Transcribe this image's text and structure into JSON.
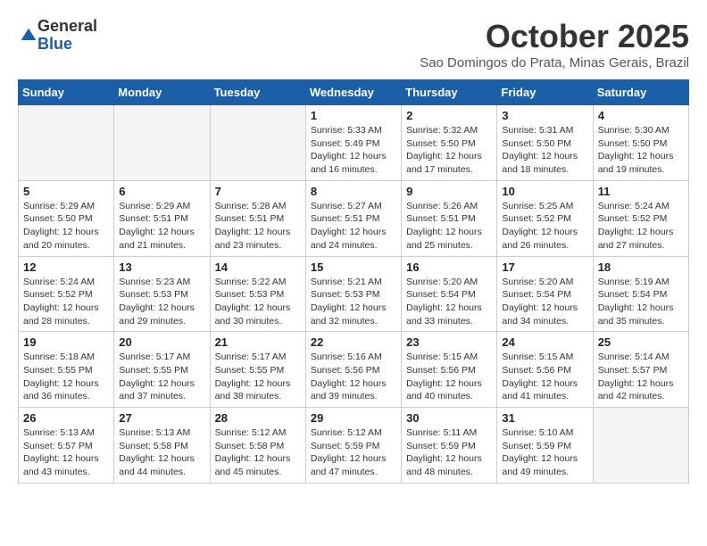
{
  "logo": {
    "general": "General",
    "blue": "Blue"
  },
  "title": "October 2025",
  "subtitle": "Sao Domingos do Prata, Minas Gerais, Brazil",
  "weekdays": [
    "Sunday",
    "Monday",
    "Tuesday",
    "Wednesday",
    "Thursday",
    "Friday",
    "Saturday"
  ],
  "weeks": [
    [
      {
        "day": "",
        "info": ""
      },
      {
        "day": "",
        "info": ""
      },
      {
        "day": "",
        "info": ""
      },
      {
        "day": "1",
        "info": "Sunrise: 5:33 AM\nSunset: 5:49 PM\nDaylight: 12 hours\nand 16 minutes."
      },
      {
        "day": "2",
        "info": "Sunrise: 5:32 AM\nSunset: 5:50 PM\nDaylight: 12 hours\nand 17 minutes."
      },
      {
        "day": "3",
        "info": "Sunrise: 5:31 AM\nSunset: 5:50 PM\nDaylight: 12 hours\nand 18 minutes."
      },
      {
        "day": "4",
        "info": "Sunrise: 5:30 AM\nSunset: 5:50 PM\nDaylight: 12 hours\nand 19 minutes."
      }
    ],
    [
      {
        "day": "5",
        "info": "Sunrise: 5:29 AM\nSunset: 5:50 PM\nDaylight: 12 hours\nand 20 minutes."
      },
      {
        "day": "6",
        "info": "Sunrise: 5:29 AM\nSunset: 5:51 PM\nDaylight: 12 hours\nand 21 minutes."
      },
      {
        "day": "7",
        "info": "Sunrise: 5:28 AM\nSunset: 5:51 PM\nDaylight: 12 hours\nand 23 minutes."
      },
      {
        "day": "8",
        "info": "Sunrise: 5:27 AM\nSunset: 5:51 PM\nDaylight: 12 hours\nand 24 minutes."
      },
      {
        "day": "9",
        "info": "Sunrise: 5:26 AM\nSunset: 5:51 PM\nDaylight: 12 hours\nand 25 minutes."
      },
      {
        "day": "10",
        "info": "Sunrise: 5:25 AM\nSunset: 5:52 PM\nDaylight: 12 hours\nand 26 minutes."
      },
      {
        "day": "11",
        "info": "Sunrise: 5:24 AM\nSunset: 5:52 PM\nDaylight: 12 hours\nand 27 minutes."
      }
    ],
    [
      {
        "day": "12",
        "info": "Sunrise: 5:24 AM\nSunset: 5:52 PM\nDaylight: 12 hours\nand 28 minutes."
      },
      {
        "day": "13",
        "info": "Sunrise: 5:23 AM\nSunset: 5:53 PM\nDaylight: 12 hours\nand 29 minutes."
      },
      {
        "day": "14",
        "info": "Sunrise: 5:22 AM\nSunset: 5:53 PM\nDaylight: 12 hours\nand 30 minutes."
      },
      {
        "day": "15",
        "info": "Sunrise: 5:21 AM\nSunset: 5:53 PM\nDaylight: 12 hours\nand 32 minutes."
      },
      {
        "day": "16",
        "info": "Sunrise: 5:20 AM\nSunset: 5:54 PM\nDaylight: 12 hours\nand 33 minutes."
      },
      {
        "day": "17",
        "info": "Sunrise: 5:20 AM\nSunset: 5:54 PM\nDaylight: 12 hours\nand 34 minutes."
      },
      {
        "day": "18",
        "info": "Sunrise: 5:19 AM\nSunset: 5:54 PM\nDaylight: 12 hours\nand 35 minutes."
      }
    ],
    [
      {
        "day": "19",
        "info": "Sunrise: 5:18 AM\nSunset: 5:55 PM\nDaylight: 12 hours\nand 36 minutes."
      },
      {
        "day": "20",
        "info": "Sunrise: 5:17 AM\nSunset: 5:55 PM\nDaylight: 12 hours\nand 37 minutes."
      },
      {
        "day": "21",
        "info": "Sunrise: 5:17 AM\nSunset: 5:55 PM\nDaylight: 12 hours\nand 38 minutes."
      },
      {
        "day": "22",
        "info": "Sunrise: 5:16 AM\nSunset: 5:56 PM\nDaylight: 12 hours\nand 39 minutes."
      },
      {
        "day": "23",
        "info": "Sunrise: 5:15 AM\nSunset: 5:56 PM\nDaylight: 12 hours\nand 40 minutes."
      },
      {
        "day": "24",
        "info": "Sunrise: 5:15 AM\nSunset: 5:56 PM\nDaylight: 12 hours\nand 41 minutes."
      },
      {
        "day": "25",
        "info": "Sunrise: 5:14 AM\nSunset: 5:57 PM\nDaylight: 12 hours\nand 42 minutes."
      }
    ],
    [
      {
        "day": "26",
        "info": "Sunrise: 5:13 AM\nSunset: 5:57 PM\nDaylight: 12 hours\nand 43 minutes."
      },
      {
        "day": "27",
        "info": "Sunrise: 5:13 AM\nSunset: 5:58 PM\nDaylight: 12 hours\nand 44 minutes."
      },
      {
        "day": "28",
        "info": "Sunrise: 5:12 AM\nSunset: 5:58 PM\nDaylight: 12 hours\nand 45 minutes."
      },
      {
        "day": "29",
        "info": "Sunrise: 5:12 AM\nSunset: 5:59 PM\nDaylight: 12 hours\nand 47 minutes."
      },
      {
        "day": "30",
        "info": "Sunrise: 5:11 AM\nSunset: 5:59 PM\nDaylight: 12 hours\nand 48 minutes."
      },
      {
        "day": "31",
        "info": "Sunrise: 5:10 AM\nSunset: 5:59 PM\nDaylight: 12 hours\nand 49 minutes."
      },
      {
        "day": "",
        "info": ""
      }
    ]
  ]
}
